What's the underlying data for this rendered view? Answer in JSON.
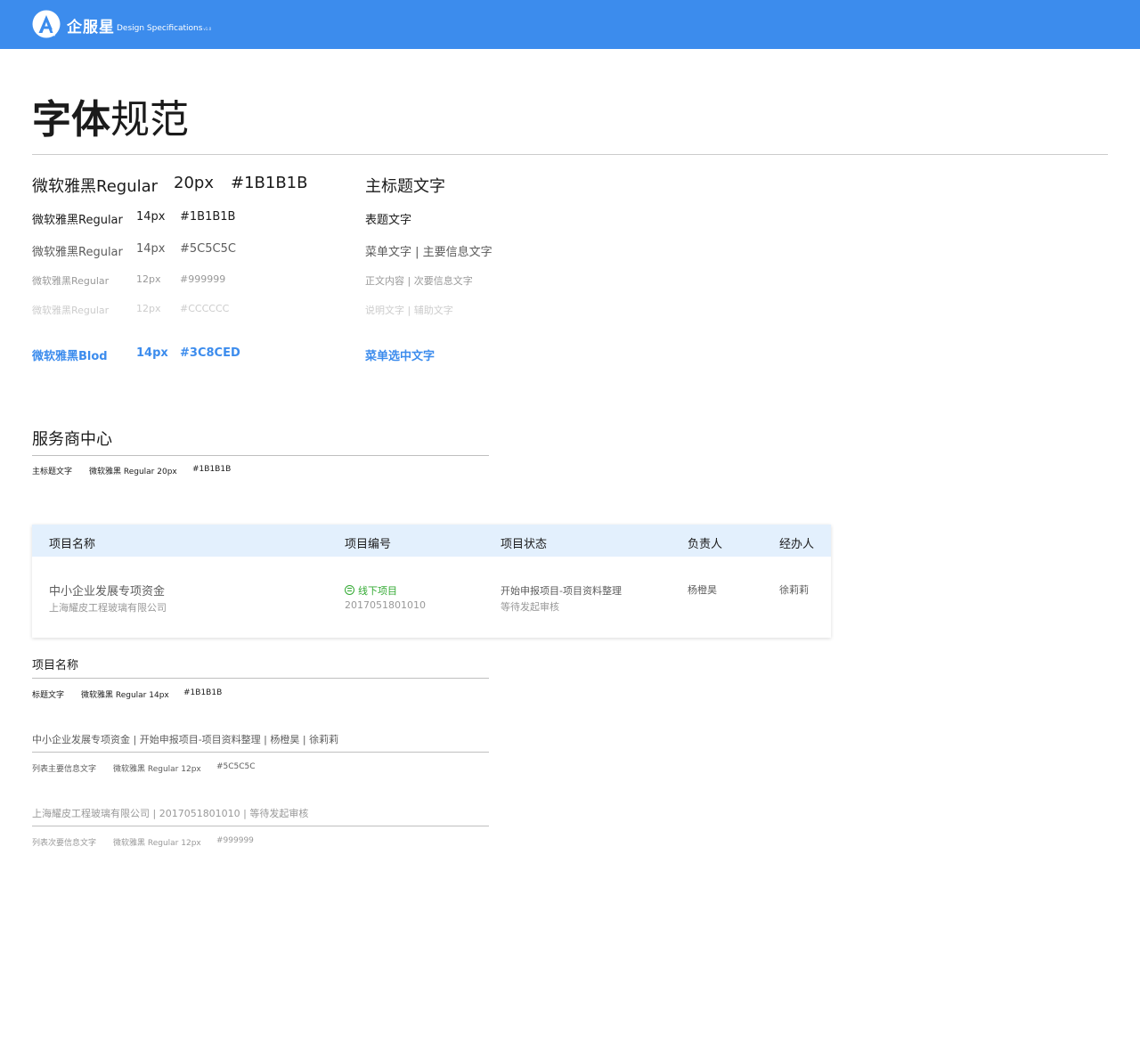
{
  "header": {
    "brand_name": "企服星",
    "brand_subtitle": "Design Specifications",
    "version": "v1.0",
    "bg_color": "#3C8CED"
  },
  "page": {
    "title_bold": "字体",
    "title_light": "规范"
  },
  "specs": [
    {
      "font": "微软雅黑Regular",
      "size": "20px",
      "color": "#1B1B1B",
      "usage": "主标题文字"
    },
    {
      "font": "微软雅黑Regular",
      "size": "14px",
      "color": "#1B1B1B",
      "usage": "表题文字"
    },
    {
      "font": "微软雅黑Regular",
      "size": "14px",
      "color": "#5C5C5C",
      "usage": "菜单文字 | 主要信息文字"
    },
    {
      "font": "微软雅黑Regular",
      "size": "12px",
      "color": "#999999",
      "usage": "正文内容 | 次要信息文字"
    },
    {
      "font": "微软雅黑Regular",
      "size": "12px",
      "color": "#CCCCCC",
      "usage": "说明文字 | 辅助文字"
    },
    {
      "font": "微软雅黑Blod",
      "size": "14px",
      "color": "#3C8CED",
      "usage": "菜单选中文字"
    }
  ],
  "example_title": {
    "text": "服务商中心",
    "note_usage": "主标题文字",
    "note_font": "微软雅黑 Regular 20px",
    "note_color": "#1B1B1B"
  },
  "table": {
    "headers": [
      "项目名称",
      "项目编号",
      "项目状态",
      "负责人",
      "经办人"
    ],
    "row": {
      "name": "中小企业发展专项资金",
      "company": "上海耀皮工程玻璃有限公司",
      "type_label": "线下项目",
      "number": "2017051801010",
      "status": "开始申报项目-项目资料整理",
      "status_sub": "等待发起审核",
      "owner": "杨橙昊",
      "handler": "徐莉莉"
    },
    "status_color": "#33AA33"
  },
  "example_header": {
    "text": "项目名称",
    "note_usage": "标题文字",
    "note_font": "微软雅黑 Regular 14px",
    "note_color": "#1B1B1B"
  },
  "example_primary": {
    "text": "中小企业发展专项资金 | 开始申报项目-项目资料整理 | 杨橙昊 | 徐莉莉",
    "note_usage": "列表主要信息文字",
    "note_font": "微软雅黑 Regular 12px",
    "note_color": "#5C5C5C"
  },
  "example_secondary": {
    "text": "上海耀皮工程玻璃有限公司 | 2017051801010 | 等待发起审核",
    "note_usage": "列表次要信息文字",
    "note_font": "微软雅黑 Regular 12px",
    "note_color": "#999999"
  }
}
